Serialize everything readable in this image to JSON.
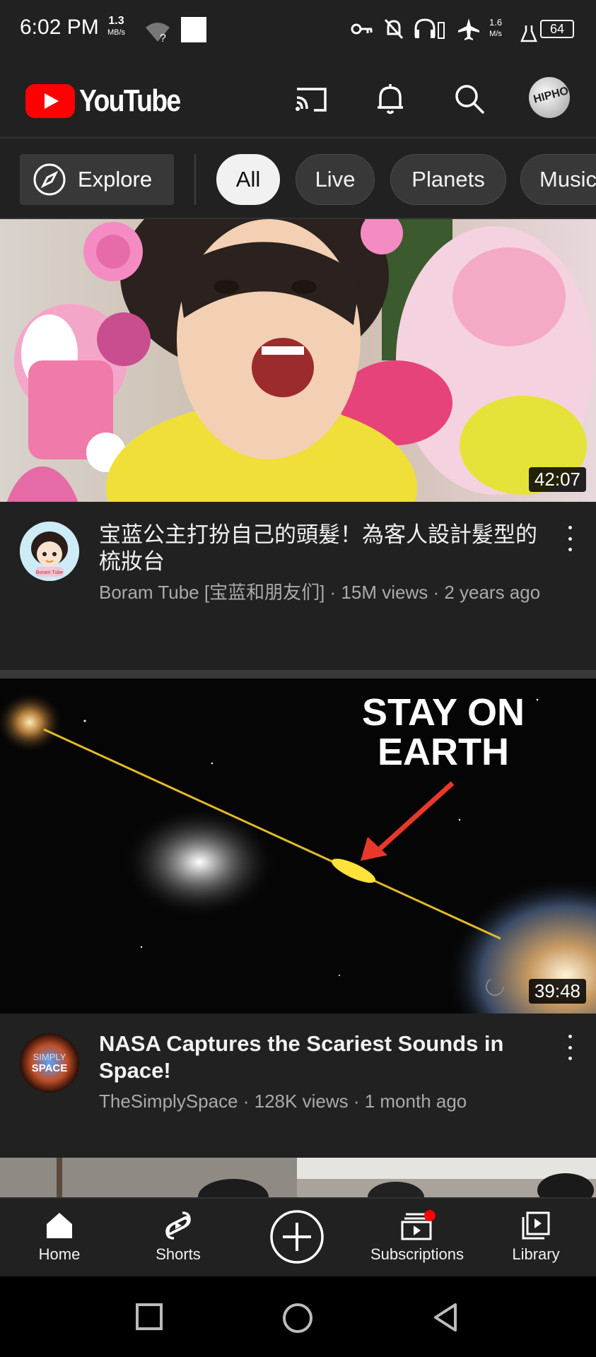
{
  "status_bar": {
    "time": "6:02 PM",
    "net_speed_left": "1.3",
    "net_speed_left_unit": "MB/s",
    "net_speed_right": "1.6",
    "net_speed_right_unit": "M/s",
    "battery": "64"
  },
  "header": {
    "logo_text": "YouTube"
  },
  "chips": {
    "explore_label": "Explore",
    "items": [
      "All",
      "Live",
      "Planets",
      "Music"
    ],
    "selected": "All"
  },
  "videos": [
    {
      "title": "宝蓝公主打扮自己的頭髮！為客人設計髮型的梳妝台",
      "channel": "Boram Tube [宝蓝和朋友们]",
      "views": "15M views",
      "age": "2 years ago",
      "subtitle": "Boram Tube [宝蓝和朋友们] · 15M views · 2 years ago",
      "duration": "42:07",
      "channel_avatar_text": "Boram Tube"
    },
    {
      "title": "NASA Captures the Scariest Sounds in Space!",
      "channel": "TheSimplySpace",
      "views": "128K views",
      "age": "1 month ago",
      "subtitle": "TheSimplySpace · 128K views · 1 month ago",
      "duration": "39:48",
      "thumbnail_text": [
        "STAY ON",
        "EARTH"
      ],
      "channel_avatar_text": [
        "SIMPLY",
        "SPACE"
      ]
    }
  ],
  "bottom_nav": {
    "home": "Home",
    "shorts": "Shorts",
    "create": "",
    "subscriptions": "Subscriptions",
    "library": "Library"
  },
  "avatar_text": "HIPHOP",
  "colors": {
    "background": "#212121",
    "brand_red": "#ff0000",
    "text_primary": "#f1f1f1",
    "text_secondary": "#aaaaaa"
  }
}
